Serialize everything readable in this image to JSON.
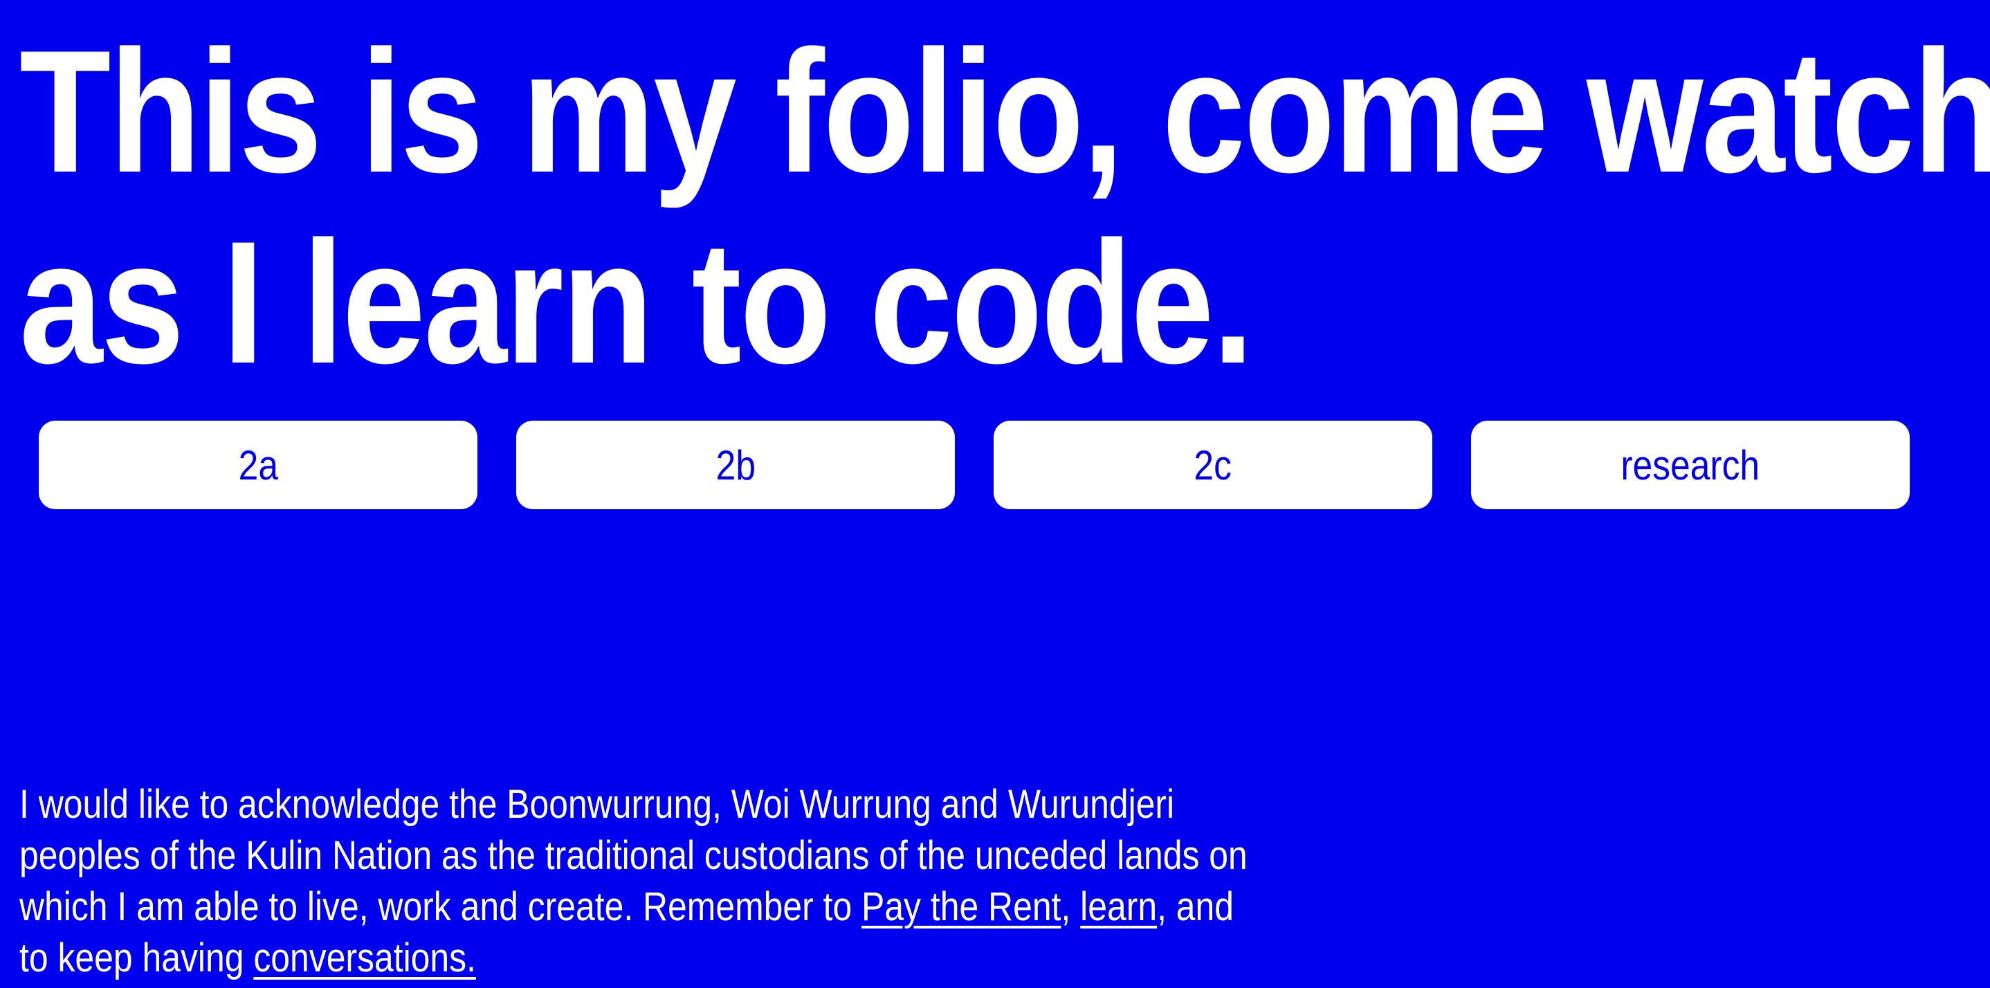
{
  "colors": {
    "background": "#0000ee",
    "text": "#ffffff",
    "button_background": "#ffffff",
    "button_text": "#0000ee"
  },
  "headline": {
    "line1": "This is my folio, come watch",
    "line2": "as I learn to code."
  },
  "nav": {
    "items": [
      {
        "label": "2a"
      },
      {
        "label": "2b"
      },
      {
        "label": "2c"
      },
      {
        "label": "research"
      }
    ]
  },
  "acknowledgement": {
    "line1": "I would like to acknowledge the Boonwurrung, Woi Wurrung and Wurundjeri",
    "line2": "peoples of the Kulin Nation as the traditional custodians of the unceded lands on",
    "line3_before": "which I am able to live, work and create. Remember to ",
    "pay_the_rent_link": "Pay the Rent",
    "comma": ",",
    "learn_link": "learn",
    "after_learn": ", and",
    "line4_before": "to keep having ",
    "conversations_link": "conversations."
  }
}
